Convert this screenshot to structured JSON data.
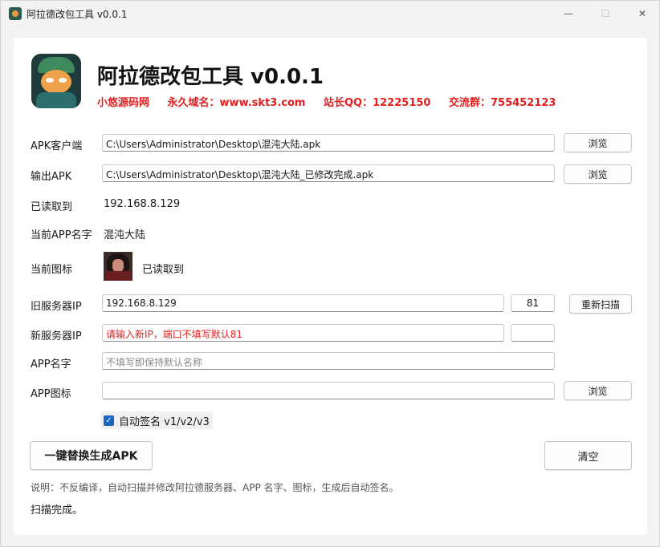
{
  "window": {
    "title": "阿拉德改包工具 v0.0.1",
    "minimize_glyph": "—",
    "maximize_glyph": "☐",
    "close_glyph": "✕"
  },
  "header": {
    "title": "阿拉德改包工具 v0.0.1",
    "promo": {
      "site": "小悠源码网",
      "domain": "永久域名：www.skt3.com",
      "qq": "站长QQ：12225150",
      "group": "交流群：755452123"
    }
  },
  "form": {
    "apk_client": {
      "label": "APK客户端",
      "value": "C:\\Users\\Administrator\\Desktop\\混沌大陆.apk",
      "button": "浏览"
    },
    "output_apk": {
      "label": "输出APK",
      "value": "C:\\Users\\Administrator\\Desktop\\混沌大陆_已修改完成.apk",
      "button": "浏览"
    },
    "read": {
      "label": "已读取到",
      "value": "192.168.8.129"
    },
    "app_name_current": {
      "label": "当前APP名字",
      "value": "混沌大陆"
    },
    "icon_current": {
      "label": "当前图标",
      "status": "已读取到"
    },
    "old_server": {
      "label": "旧服务器IP",
      "value": "192.168.8.129",
      "port": "81",
      "button": "重新扫描"
    },
    "new_server": {
      "label": "新服务器IP",
      "value": "请输入新IP，端口不填写默认81",
      "port": ""
    },
    "app_name": {
      "label": "APP名字",
      "placeholder": "不填写即保持默认名称"
    },
    "app_icon": {
      "label": "APP图标",
      "value": "",
      "button": "浏览"
    },
    "auto_sign": {
      "label": "自动签名 v1/v2/v3",
      "checked": true
    }
  },
  "actions": {
    "generate": "一键替换生成APK",
    "clear": "清空"
  },
  "note": "说明：不反编译，自动扫描并修改阿拉德服务器、APP 名字、图标，生成后自动签名。",
  "status": "扫描完成。",
  "colors": {
    "promo": "#e02020",
    "checkbox": "#1a66c2"
  }
}
